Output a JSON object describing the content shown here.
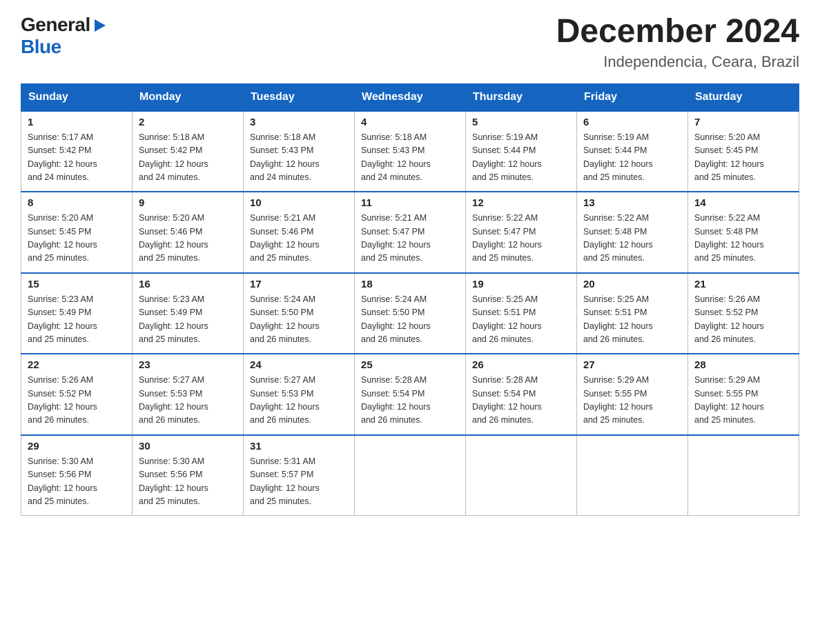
{
  "header": {
    "logo": {
      "general": "General",
      "blue": "Blue"
    },
    "title": "December 2024",
    "location": "Independencia, Ceara, Brazil"
  },
  "calendar": {
    "days_of_week": [
      "Sunday",
      "Monday",
      "Tuesday",
      "Wednesday",
      "Thursday",
      "Friday",
      "Saturday"
    ],
    "weeks": [
      [
        {
          "day": "1",
          "sunrise": "Sunrise: 5:17 AM",
          "sunset": "Sunset: 5:42 PM",
          "daylight": "Daylight: 12 hours and 24 minutes."
        },
        {
          "day": "2",
          "sunrise": "Sunrise: 5:18 AM",
          "sunset": "Sunset: 5:42 PM",
          "daylight": "Daylight: 12 hours and 24 minutes."
        },
        {
          "day": "3",
          "sunrise": "Sunrise: 5:18 AM",
          "sunset": "Sunset: 5:43 PM",
          "daylight": "Daylight: 12 hours and 24 minutes."
        },
        {
          "day": "4",
          "sunrise": "Sunrise: 5:18 AM",
          "sunset": "Sunset: 5:43 PM",
          "daylight": "Daylight: 12 hours and 24 minutes."
        },
        {
          "day": "5",
          "sunrise": "Sunrise: 5:19 AM",
          "sunset": "Sunset: 5:44 PM",
          "daylight": "Daylight: 12 hours and 25 minutes."
        },
        {
          "day": "6",
          "sunrise": "Sunrise: 5:19 AM",
          "sunset": "Sunset: 5:44 PM",
          "daylight": "Daylight: 12 hours and 25 minutes."
        },
        {
          "day": "7",
          "sunrise": "Sunrise: 5:20 AM",
          "sunset": "Sunset: 5:45 PM",
          "daylight": "Daylight: 12 hours and 25 minutes."
        }
      ],
      [
        {
          "day": "8",
          "sunrise": "Sunrise: 5:20 AM",
          "sunset": "Sunset: 5:45 PM",
          "daylight": "Daylight: 12 hours and 25 minutes."
        },
        {
          "day": "9",
          "sunrise": "Sunrise: 5:20 AM",
          "sunset": "Sunset: 5:46 PM",
          "daylight": "Daylight: 12 hours and 25 minutes."
        },
        {
          "day": "10",
          "sunrise": "Sunrise: 5:21 AM",
          "sunset": "Sunset: 5:46 PM",
          "daylight": "Daylight: 12 hours and 25 minutes."
        },
        {
          "day": "11",
          "sunrise": "Sunrise: 5:21 AM",
          "sunset": "Sunset: 5:47 PM",
          "daylight": "Daylight: 12 hours and 25 minutes."
        },
        {
          "day": "12",
          "sunrise": "Sunrise: 5:22 AM",
          "sunset": "Sunset: 5:47 PM",
          "daylight": "Daylight: 12 hours and 25 minutes."
        },
        {
          "day": "13",
          "sunrise": "Sunrise: 5:22 AM",
          "sunset": "Sunset: 5:48 PM",
          "daylight": "Daylight: 12 hours and 25 minutes."
        },
        {
          "day": "14",
          "sunrise": "Sunrise: 5:22 AM",
          "sunset": "Sunset: 5:48 PM",
          "daylight": "Daylight: 12 hours and 25 minutes."
        }
      ],
      [
        {
          "day": "15",
          "sunrise": "Sunrise: 5:23 AM",
          "sunset": "Sunset: 5:49 PM",
          "daylight": "Daylight: 12 hours and 25 minutes."
        },
        {
          "day": "16",
          "sunrise": "Sunrise: 5:23 AM",
          "sunset": "Sunset: 5:49 PM",
          "daylight": "Daylight: 12 hours and 25 minutes."
        },
        {
          "day": "17",
          "sunrise": "Sunrise: 5:24 AM",
          "sunset": "Sunset: 5:50 PM",
          "daylight": "Daylight: 12 hours and 26 minutes."
        },
        {
          "day": "18",
          "sunrise": "Sunrise: 5:24 AM",
          "sunset": "Sunset: 5:50 PM",
          "daylight": "Daylight: 12 hours and 26 minutes."
        },
        {
          "day": "19",
          "sunrise": "Sunrise: 5:25 AM",
          "sunset": "Sunset: 5:51 PM",
          "daylight": "Daylight: 12 hours and 26 minutes."
        },
        {
          "day": "20",
          "sunrise": "Sunrise: 5:25 AM",
          "sunset": "Sunset: 5:51 PM",
          "daylight": "Daylight: 12 hours and 26 minutes."
        },
        {
          "day": "21",
          "sunrise": "Sunrise: 5:26 AM",
          "sunset": "Sunset: 5:52 PM",
          "daylight": "Daylight: 12 hours and 26 minutes."
        }
      ],
      [
        {
          "day": "22",
          "sunrise": "Sunrise: 5:26 AM",
          "sunset": "Sunset: 5:52 PM",
          "daylight": "Daylight: 12 hours and 26 minutes."
        },
        {
          "day": "23",
          "sunrise": "Sunrise: 5:27 AM",
          "sunset": "Sunset: 5:53 PM",
          "daylight": "Daylight: 12 hours and 26 minutes."
        },
        {
          "day": "24",
          "sunrise": "Sunrise: 5:27 AM",
          "sunset": "Sunset: 5:53 PM",
          "daylight": "Daylight: 12 hours and 26 minutes."
        },
        {
          "day": "25",
          "sunrise": "Sunrise: 5:28 AM",
          "sunset": "Sunset: 5:54 PM",
          "daylight": "Daylight: 12 hours and 26 minutes."
        },
        {
          "day": "26",
          "sunrise": "Sunrise: 5:28 AM",
          "sunset": "Sunset: 5:54 PM",
          "daylight": "Daylight: 12 hours and 26 minutes."
        },
        {
          "day": "27",
          "sunrise": "Sunrise: 5:29 AM",
          "sunset": "Sunset: 5:55 PM",
          "daylight": "Daylight: 12 hours and 25 minutes."
        },
        {
          "day": "28",
          "sunrise": "Sunrise: 5:29 AM",
          "sunset": "Sunset: 5:55 PM",
          "daylight": "Daylight: 12 hours and 25 minutes."
        }
      ],
      [
        {
          "day": "29",
          "sunrise": "Sunrise: 5:30 AM",
          "sunset": "Sunset: 5:56 PM",
          "daylight": "Daylight: 12 hours and 25 minutes."
        },
        {
          "day": "30",
          "sunrise": "Sunrise: 5:30 AM",
          "sunset": "Sunset: 5:56 PM",
          "daylight": "Daylight: 12 hours and 25 minutes."
        },
        {
          "day": "31",
          "sunrise": "Sunrise: 5:31 AM",
          "sunset": "Sunset: 5:57 PM",
          "daylight": "Daylight: 12 hours and 25 minutes."
        },
        {
          "day": "",
          "sunrise": "",
          "sunset": "",
          "daylight": ""
        },
        {
          "day": "",
          "sunrise": "",
          "sunset": "",
          "daylight": ""
        },
        {
          "day": "",
          "sunrise": "",
          "sunset": "",
          "daylight": ""
        },
        {
          "day": "",
          "sunrise": "",
          "sunset": "",
          "daylight": ""
        }
      ]
    ]
  }
}
